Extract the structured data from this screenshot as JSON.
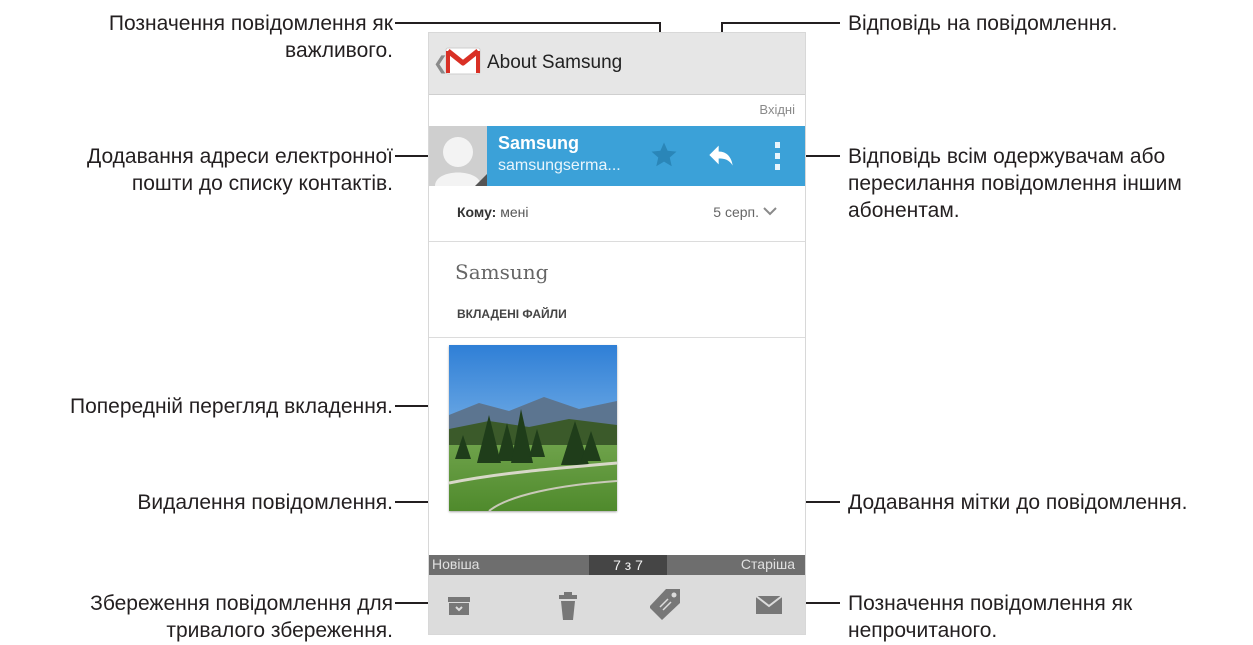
{
  "callouts": {
    "star": "Позначення повідомлення як\nважливого.",
    "add_contact": "Додавання адреси електронної\nпошти до списку контактів.",
    "preview": "Попередній перегляд вкладення.",
    "delete": "Видалення повідомлення.",
    "archive": "Збереження повідомлення для\nтривалого збереження.",
    "reply": "Відповідь на повідомлення.",
    "more": "Відповідь всім одержувачам або\nпересилання повідомлення іншим\nабонентам.",
    "label": "Додавання мітки до повідомлення.",
    "unread": "Позначення повідомлення як\nнепрочитаного."
  },
  "app": {
    "title": "About Samsung"
  },
  "folder": "Вхідні",
  "sender": {
    "name": "Samsung",
    "email": "samsungserma..."
  },
  "recipient": {
    "to_label": "Кому:",
    "to_value": "мені",
    "date": "5 серп."
  },
  "message": {
    "subject": "Samsung",
    "attachments_header": "ВКЛАДЕНІ ФАЙЛИ"
  },
  "pager": {
    "newer": "Новіша",
    "position": "7 з 7",
    "older": "Старіша"
  },
  "colors": {
    "sender_band": "#3ba1d8",
    "appbar": "#e6e6e6",
    "bottombar": "#dcdcdc",
    "callout_text": "#231f20"
  },
  "icons": {
    "gmail": "gmail-icon",
    "back": "chevron-left-icon",
    "avatar": "contact-avatar-icon",
    "star": "star-icon",
    "reply": "reply-icon",
    "more": "overflow-menu-icon",
    "expand": "chevron-down-icon",
    "archive": "archive-icon",
    "delete": "trash-icon",
    "label": "label-tag-icon",
    "unread": "mark-unread-icon"
  }
}
